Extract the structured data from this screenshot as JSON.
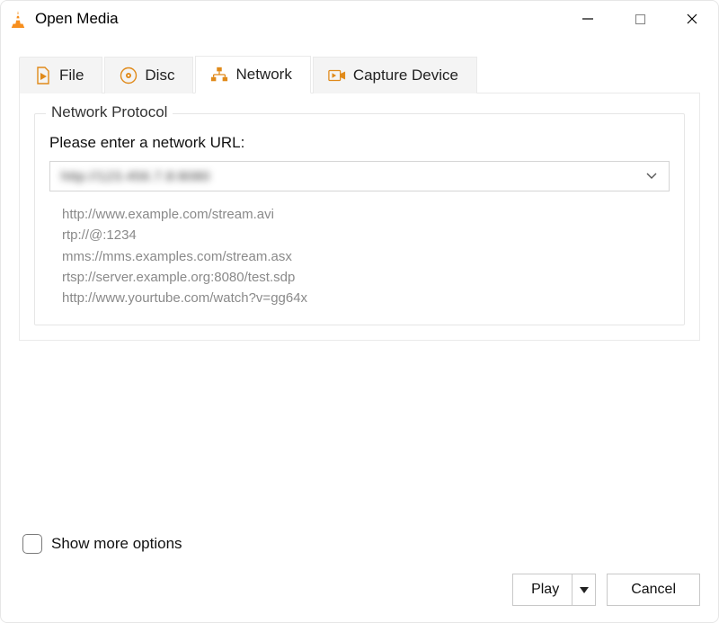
{
  "window": {
    "title": "Open Media"
  },
  "tabs": {
    "file": "File",
    "disc": "Disc",
    "network": "Network",
    "capture": "Capture Device"
  },
  "panel": {
    "legend": "Network Protocol",
    "prompt": "Please enter a network URL:",
    "url_value": "http://123.456.7.8:8080",
    "examples": [
      "http://www.example.com/stream.avi",
      "rtp://@:1234",
      "mms://mms.examples.com/stream.asx",
      "rtsp://server.example.org:8080/test.sdp",
      "http://www.yourtube.com/watch?v=gg64x"
    ]
  },
  "options": {
    "show_more_label": "Show more options",
    "show_more_checked": false
  },
  "buttons": {
    "play": "Play",
    "cancel": "Cancel"
  }
}
